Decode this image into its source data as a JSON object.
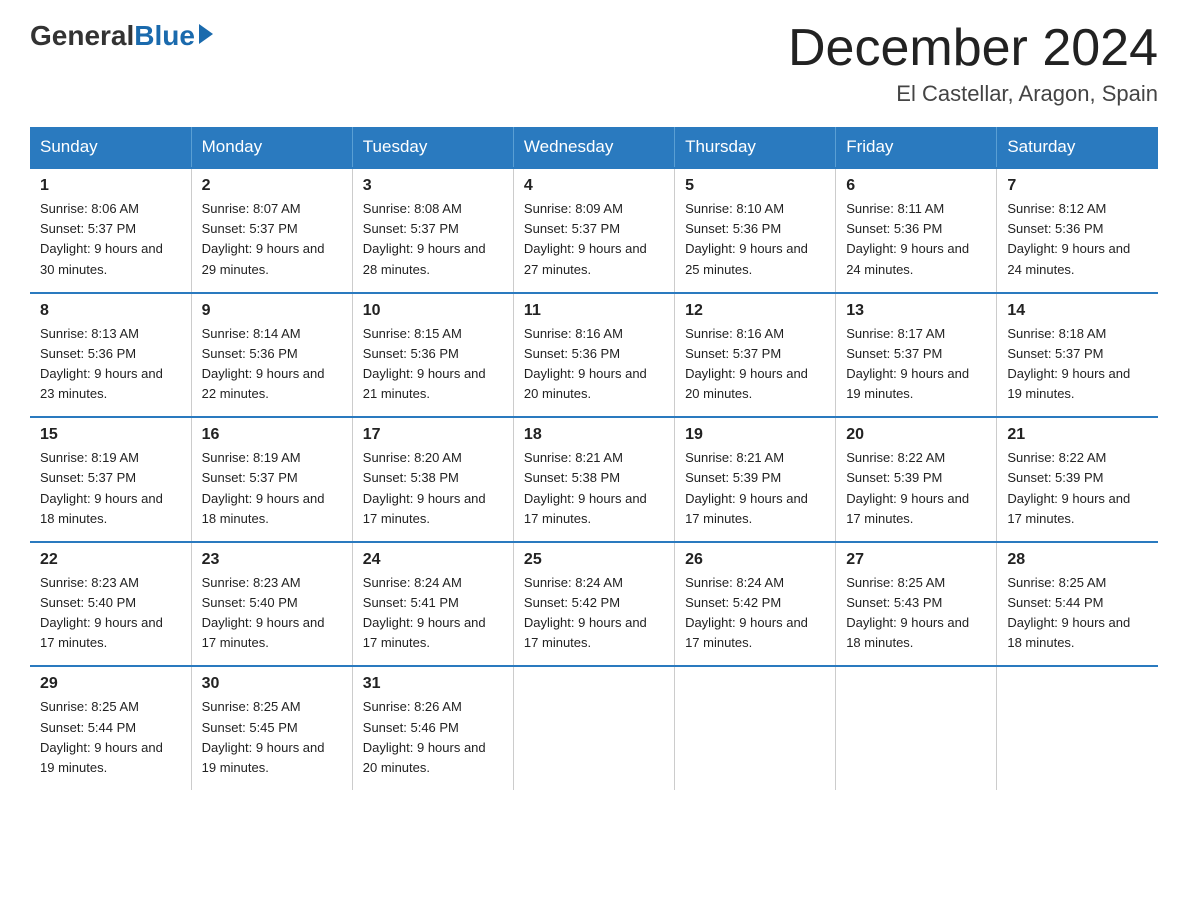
{
  "header": {
    "logo_general": "General",
    "logo_blue": "Blue",
    "month_title": "December 2024",
    "location": "El Castellar, Aragon, Spain"
  },
  "weekdays": [
    "Sunday",
    "Monday",
    "Tuesday",
    "Wednesday",
    "Thursday",
    "Friday",
    "Saturday"
  ],
  "weeks": [
    [
      {
        "day": "1",
        "sunrise": "8:06 AM",
        "sunset": "5:37 PM",
        "daylight": "9 hours and 30 minutes."
      },
      {
        "day": "2",
        "sunrise": "8:07 AM",
        "sunset": "5:37 PM",
        "daylight": "9 hours and 29 minutes."
      },
      {
        "day": "3",
        "sunrise": "8:08 AM",
        "sunset": "5:37 PM",
        "daylight": "9 hours and 28 minutes."
      },
      {
        "day": "4",
        "sunrise": "8:09 AM",
        "sunset": "5:37 PM",
        "daylight": "9 hours and 27 minutes."
      },
      {
        "day": "5",
        "sunrise": "8:10 AM",
        "sunset": "5:36 PM",
        "daylight": "9 hours and 25 minutes."
      },
      {
        "day": "6",
        "sunrise": "8:11 AM",
        "sunset": "5:36 PM",
        "daylight": "9 hours and 24 minutes."
      },
      {
        "day": "7",
        "sunrise": "8:12 AM",
        "sunset": "5:36 PM",
        "daylight": "9 hours and 24 minutes."
      }
    ],
    [
      {
        "day": "8",
        "sunrise": "8:13 AM",
        "sunset": "5:36 PM",
        "daylight": "9 hours and 23 minutes."
      },
      {
        "day": "9",
        "sunrise": "8:14 AM",
        "sunset": "5:36 PM",
        "daylight": "9 hours and 22 minutes."
      },
      {
        "day": "10",
        "sunrise": "8:15 AM",
        "sunset": "5:36 PM",
        "daylight": "9 hours and 21 minutes."
      },
      {
        "day": "11",
        "sunrise": "8:16 AM",
        "sunset": "5:36 PM",
        "daylight": "9 hours and 20 minutes."
      },
      {
        "day": "12",
        "sunrise": "8:16 AM",
        "sunset": "5:37 PM",
        "daylight": "9 hours and 20 minutes."
      },
      {
        "day": "13",
        "sunrise": "8:17 AM",
        "sunset": "5:37 PM",
        "daylight": "9 hours and 19 minutes."
      },
      {
        "day": "14",
        "sunrise": "8:18 AM",
        "sunset": "5:37 PM",
        "daylight": "9 hours and 19 minutes."
      }
    ],
    [
      {
        "day": "15",
        "sunrise": "8:19 AM",
        "sunset": "5:37 PM",
        "daylight": "9 hours and 18 minutes."
      },
      {
        "day": "16",
        "sunrise": "8:19 AM",
        "sunset": "5:37 PM",
        "daylight": "9 hours and 18 minutes."
      },
      {
        "day": "17",
        "sunrise": "8:20 AM",
        "sunset": "5:38 PM",
        "daylight": "9 hours and 17 minutes."
      },
      {
        "day": "18",
        "sunrise": "8:21 AM",
        "sunset": "5:38 PM",
        "daylight": "9 hours and 17 minutes."
      },
      {
        "day": "19",
        "sunrise": "8:21 AM",
        "sunset": "5:39 PM",
        "daylight": "9 hours and 17 minutes."
      },
      {
        "day": "20",
        "sunrise": "8:22 AM",
        "sunset": "5:39 PM",
        "daylight": "9 hours and 17 minutes."
      },
      {
        "day": "21",
        "sunrise": "8:22 AM",
        "sunset": "5:39 PM",
        "daylight": "9 hours and 17 minutes."
      }
    ],
    [
      {
        "day": "22",
        "sunrise": "8:23 AM",
        "sunset": "5:40 PM",
        "daylight": "9 hours and 17 minutes."
      },
      {
        "day": "23",
        "sunrise": "8:23 AM",
        "sunset": "5:40 PM",
        "daylight": "9 hours and 17 minutes."
      },
      {
        "day": "24",
        "sunrise": "8:24 AM",
        "sunset": "5:41 PM",
        "daylight": "9 hours and 17 minutes."
      },
      {
        "day": "25",
        "sunrise": "8:24 AM",
        "sunset": "5:42 PM",
        "daylight": "9 hours and 17 minutes."
      },
      {
        "day": "26",
        "sunrise": "8:24 AM",
        "sunset": "5:42 PM",
        "daylight": "9 hours and 17 minutes."
      },
      {
        "day": "27",
        "sunrise": "8:25 AM",
        "sunset": "5:43 PM",
        "daylight": "9 hours and 18 minutes."
      },
      {
        "day": "28",
        "sunrise": "8:25 AM",
        "sunset": "5:44 PM",
        "daylight": "9 hours and 18 minutes."
      }
    ],
    [
      {
        "day": "29",
        "sunrise": "8:25 AM",
        "sunset": "5:44 PM",
        "daylight": "9 hours and 19 minutes."
      },
      {
        "day": "30",
        "sunrise": "8:25 AM",
        "sunset": "5:45 PM",
        "daylight": "9 hours and 19 minutes."
      },
      {
        "day": "31",
        "sunrise": "8:26 AM",
        "sunset": "5:46 PM",
        "daylight": "9 hours and 20 minutes."
      },
      null,
      null,
      null,
      null
    ]
  ]
}
